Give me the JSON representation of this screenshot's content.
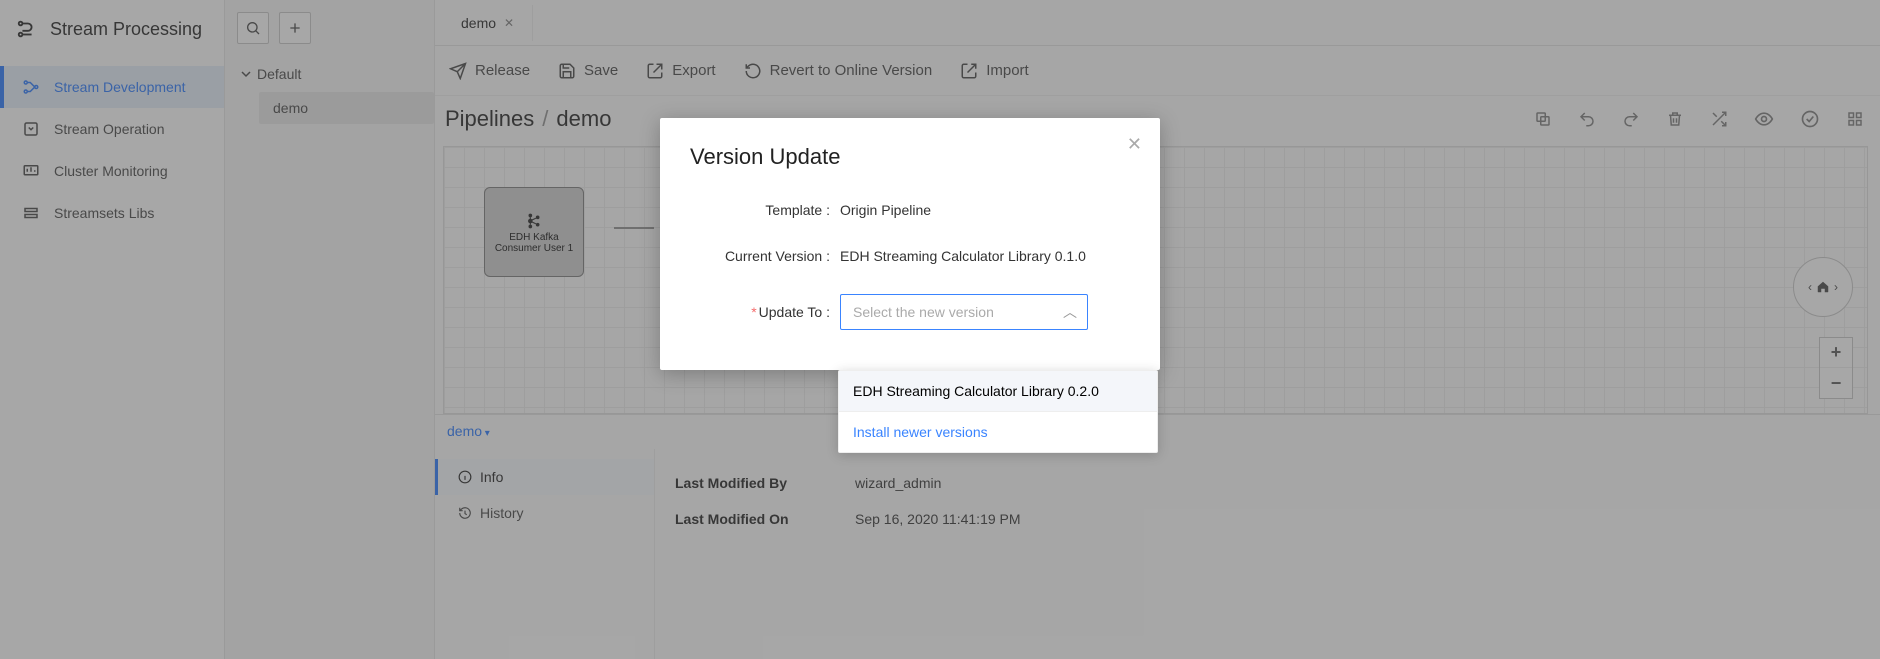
{
  "sidebar": {
    "title": "Stream Processing",
    "items": [
      {
        "label": "Stream Development"
      },
      {
        "label": "Stream Operation"
      },
      {
        "label": "Cluster Monitoring"
      },
      {
        "label": "Streamsets Libs"
      }
    ]
  },
  "tree": {
    "root": "Default",
    "leaf": "demo"
  },
  "tab": {
    "label": "demo"
  },
  "actions": {
    "release": "Release",
    "save": "Save",
    "export": "Export",
    "revert": "Revert to Online Version",
    "import": "Import"
  },
  "breadcrumb": {
    "parent": "Pipelines",
    "current": "demo"
  },
  "canvas": {
    "node_label_l1": "EDH Kafka",
    "node_label_l2": "Consumer User 1"
  },
  "bottom": {
    "tab": "demo",
    "side_info": "Info",
    "side_history": "History",
    "rows": [
      {
        "label": "Last Modified By",
        "value": "wizard_admin"
      },
      {
        "label": "Last Modified On",
        "value": "Sep 16, 2020 11:41:19 PM"
      }
    ]
  },
  "modal": {
    "title": "Version Update",
    "template_label": "Template :",
    "template_value": "Origin Pipeline",
    "current_label": "Current Version :",
    "current_value": "EDH Streaming Calculator Library 0.1.0",
    "update_label": "Update To :",
    "select_placeholder": "Select the new version",
    "dropdown_option": "EDH Streaming Calculator Library 0.2.0",
    "dropdown_link": "Install newer versions"
  }
}
